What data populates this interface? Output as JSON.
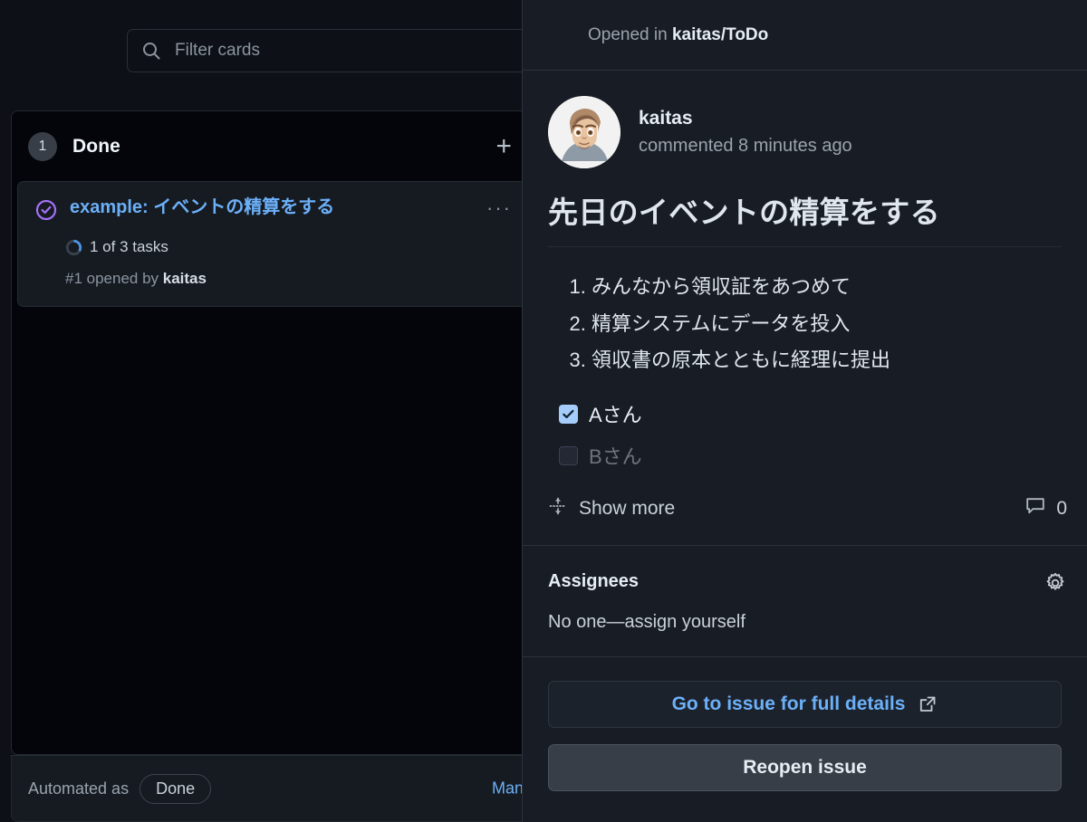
{
  "board": {
    "filter": {
      "placeholder": "Filter cards",
      "value": "",
      "icon": "search-icon"
    },
    "column": {
      "count": "1",
      "title": "Done",
      "add_label": "+",
      "card": {
        "state_icon": "issue-closed-icon",
        "title": "example: イベントの精算をする",
        "more_label": "···",
        "tasks_text": "1 of 3 tasks",
        "tasks_done": 1,
        "tasks_total": 3,
        "meta_prefix": "#1 opened by ",
        "meta_author": "kaitas"
      }
    },
    "footer": {
      "automated_label": "Automated as",
      "automated_value": "Done",
      "manage_label": "Manage"
    }
  },
  "panel": {
    "topbar": {
      "prefix": "Opened in ",
      "repo": "kaitas/ToDo"
    },
    "comment": {
      "author": "kaitas",
      "time": "commented 8 minutes ago",
      "avatar": "user-avatar"
    },
    "issue": {
      "heading": "先日のイベントの精算をする",
      "ordered_list": [
        "みんなから領収証をあつめて",
        "精算システムにデータを投入",
        "領収書の原本とともに経理に提出"
      ],
      "tasks": [
        {
          "label": "Aさん",
          "checked": true
        },
        {
          "label": "Bさん",
          "checked": false
        }
      ],
      "show_more_label": "Show more",
      "show_more_icon": "unfold-icon",
      "comment_icon": "comment-icon",
      "comment_count": "0"
    },
    "assignees": {
      "title": "Assignees",
      "value": "No one—assign yourself",
      "gear_icon": "gear-icon"
    },
    "actions": {
      "goto_label": "Go to issue for full details",
      "goto_icon": "external-link-icon",
      "reopen_label": "Reopen issue"
    }
  },
  "colors": {
    "board_bg": "#0d1117",
    "column_bg": "#04050a",
    "card_bg": "#161b22",
    "panel_bg": "#181c25",
    "accent_blue": "#6cb0f8",
    "closed_purple": "#a371f7",
    "checkbox_blue": "#a5cdfb",
    "border": "#2c313a",
    "muted_text": "#8b949e"
  }
}
